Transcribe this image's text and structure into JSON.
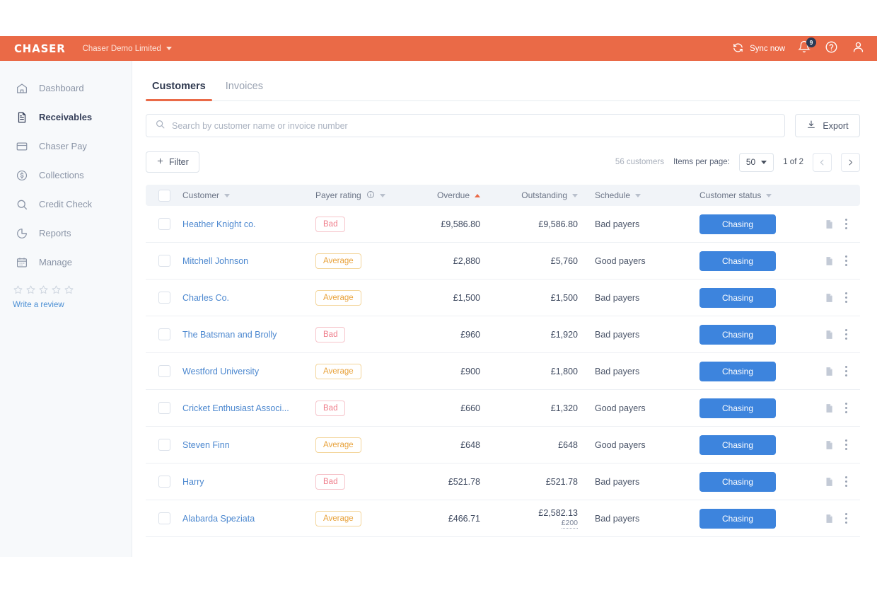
{
  "topbar": {
    "brand": "CHASER",
    "org": "Chaser Demo Limited",
    "sync_label": "Sync now",
    "notification_count": "9",
    "icons": {
      "sync": "sync-icon",
      "bell": "bell-icon",
      "help": "help-circle-icon",
      "account": "user-icon"
    },
    "colors": {
      "background": "#ea6a47",
      "badge": "#2b3a55"
    }
  },
  "sidebar": {
    "items": [
      {
        "label": "Dashboard",
        "icon": "home-icon",
        "active": false
      },
      {
        "label": "Receivables",
        "icon": "document-icon",
        "active": true
      },
      {
        "label": "Chaser Pay",
        "icon": "credit-card-icon",
        "active": false
      },
      {
        "label": "Collections",
        "icon": "dollar-circle-icon",
        "active": false
      },
      {
        "label": "Credit Check",
        "icon": "magnifier-icon",
        "active": false
      },
      {
        "label": "Reports",
        "icon": "pie-chart-icon",
        "active": false
      },
      {
        "label": "Manage",
        "icon": "calendar-icon",
        "active": false
      }
    ],
    "review": {
      "stars": 5,
      "filled": 0,
      "link_label": "Write a review"
    }
  },
  "main": {
    "tabs": [
      {
        "label": "Customers",
        "active": true
      },
      {
        "label": "Invoices",
        "active": false
      }
    ],
    "search": {
      "placeholder": "Search by customer name or invoice number",
      "value": ""
    },
    "export_label": "Export",
    "filter_label": "Filter",
    "customer_count": "56 customers",
    "items_per_page_label": "Items per page:",
    "items_per_page_value": "50",
    "page_indicator": "1 of 2",
    "table": {
      "columns": [
        {
          "label": "Customer",
          "sort": "none"
        },
        {
          "label": "Payer rating",
          "sort": "none",
          "info": true
        },
        {
          "label": "Overdue",
          "sort": "asc"
        },
        {
          "label": "Outstanding",
          "sort": "none"
        },
        {
          "label": "Schedule",
          "sort": "none"
        },
        {
          "label": "Customer status",
          "sort": "none"
        }
      ],
      "rows": [
        {
          "customer": "Heather Knight co.",
          "rating": "Bad",
          "overdue": "£9,586.80",
          "outstanding": "£9,586.80",
          "outstanding_sub": "",
          "schedule": "Bad payers",
          "status": "Chasing"
        },
        {
          "customer": "Mitchell Johnson",
          "rating": "Average",
          "overdue": "£2,880",
          "outstanding": "£5,760",
          "outstanding_sub": "",
          "schedule": "Good payers",
          "status": "Chasing"
        },
        {
          "customer": "Charles Co.",
          "rating": "Average",
          "overdue": "£1,500",
          "outstanding": "£1,500",
          "outstanding_sub": "",
          "schedule": "Bad payers",
          "status": "Chasing"
        },
        {
          "customer": "The Batsman and Brolly",
          "rating": "Bad",
          "overdue": "£960",
          "outstanding": "£1,920",
          "outstanding_sub": "",
          "schedule": "Bad payers",
          "status": "Chasing"
        },
        {
          "customer": "Westford University",
          "rating": "Average",
          "overdue": "£900",
          "outstanding": "£1,800",
          "outstanding_sub": "",
          "schedule": "Bad payers",
          "status": "Chasing"
        },
        {
          "customer": "Cricket Enthusiast Associ...",
          "rating": "Bad",
          "overdue": "£660",
          "outstanding": "£1,320",
          "outstanding_sub": "",
          "schedule": "Good payers",
          "status": "Chasing"
        },
        {
          "customer": "Steven Finn",
          "rating": "Average",
          "overdue": "£648",
          "outstanding": "£648",
          "outstanding_sub": "",
          "schedule": "Good payers",
          "status": "Chasing"
        },
        {
          "customer": "Harry",
          "rating": "Bad",
          "overdue": "£521.78",
          "outstanding": "£521.78",
          "outstanding_sub": "",
          "schedule": "Bad payers",
          "status": "Chasing"
        },
        {
          "customer": "Alabarda Speziata",
          "rating": "Average",
          "overdue": "£466.71",
          "outstanding": "£2,582.13",
          "outstanding_sub": "£200",
          "schedule": "Bad payers",
          "status": "Chasing"
        }
      ]
    },
    "row_icons": {
      "note": "document-icon",
      "menu": "kebab-menu-icon"
    }
  }
}
